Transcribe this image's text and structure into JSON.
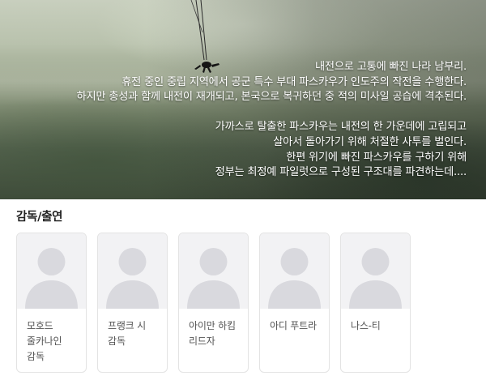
{
  "hero": {
    "synopsis_lines": [
      "내전으로 고통에 빠진 나라 남부리.",
      "휴전 중인 중립 지역에서 공군 특수 부대 파스카우가 인도주의 작전을 수행한다.",
      "하지만 총성과 함께 내전이 재개되고, 본국으로 복귀하던 중 적의 미사일 공습에 격추된다.",
      "",
      "가까스로 탈출한 파스카우는 내전의 한 가운데에 고립되고",
      "살아서 돌아가기 위해 처절한 사투를 벌인다.",
      "한편 위기에 빠진 파스카우를 구하기 위해",
      "정부는 최정예 파일럿으로 구성된 구조대를 파견하는데...."
    ]
  },
  "cast_section": {
    "title": "감독/출연",
    "members": [
      {
        "name": "모호드 줄카나인",
        "role": "감독"
      },
      {
        "name": "프랭크 시",
        "role": "감독"
      },
      {
        "name": "아이만 하킴 리드자",
        "role": ""
      },
      {
        "name": "아디 푸트라",
        "role": ""
      },
      {
        "name": "나스-티",
        "role": ""
      }
    ],
    "placeholder_icon": "person-silhouette-icon"
  }
}
